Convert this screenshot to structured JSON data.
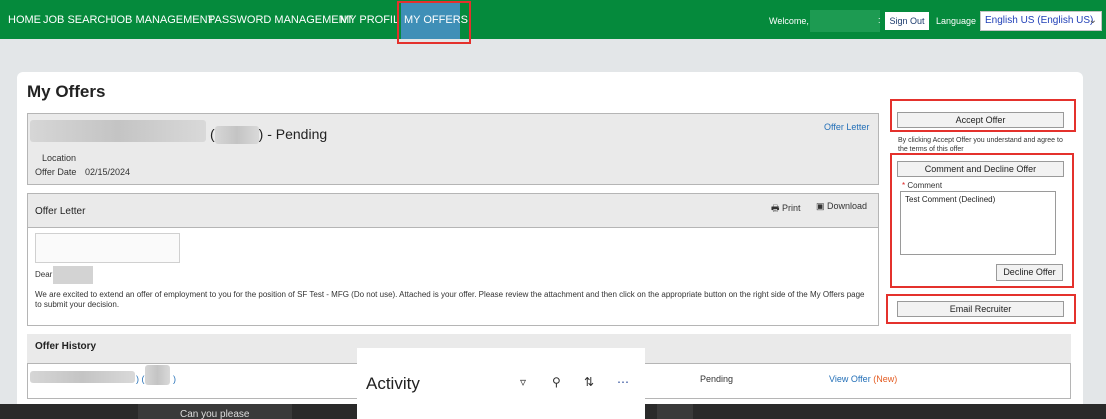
{
  "nav": {
    "items": [
      "HOME",
      "JOB SEARCH",
      "JOB MANAGEMENT",
      "PASSWORD MANAGEMENT",
      "MY PROFILE",
      "MY OFFERS"
    ],
    "active": "MY OFFERS",
    "welcome": "Welcome,",
    "sign_out": "Sign Out",
    "language_label": "Language",
    "language_value": "English US (English US)"
  },
  "page": {
    "title": "My Offers"
  },
  "offer": {
    "status_suffix": ") - Pending",
    "open_paren": "(",
    "offer_letter_link": "Offer Letter",
    "location_label": "Location",
    "date_label": "Offer Date",
    "date_value": "02/15/2024"
  },
  "letter": {
    "title": "Offer Letter",
    "print": "Print",
    "download": "Download",
    "dear": "Dear",
    "body": "We are excited to extend an offer of employment to you for the position of SF Test - MFG (Do not use). Attached is your offer. Please review the attachment and then click on the appropriate button on the right side of the My Offers page to submit your decision."
  },
  "history": {
    "title": "Offer History",
    "row": {
      "id_text": ") (",
      "id_suffix": ")",
      "status": "Pending",
      "view": "View Offer",
      "new": "(New)"
    }
  },
  "actions": {
    "accept": "Accept Offer",
    "accept_note": "By clicking Accept Offer you understand and agree to the terms of this offer",
    "comment_decline": "Comment and Decline Offer",
    "comment_label": "Comment",
    "comment_value": "Test Comment (Declined)",
    "decline": "Decline Offer",
    "email": "Email Recruiter"
  },
  "overlay": {
    "activity_title": "Activity",
    "bottom_text": "Can you please"
  },
  "colors": {
    "nav_bg": "#058a3c",
    "active_tab": "#3f8fb7",
    "highlight": "#e4312c",
    "link": "#2470b8"
  }
}
